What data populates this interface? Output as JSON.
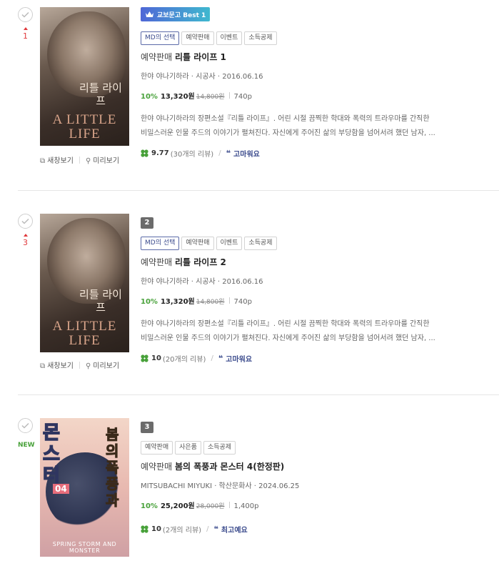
{
  "items": [
    {
      "rank_label": "1",
      "badge": "교보문고 Best 1",
      "tags": [
        "MD의 선택",
        "예약판매",
        "이벤트",
        "소득공제"
      ],
      "title_prefix": "예약판매",
      "title": "리틀 라이프 1",
      "meta": "한야 야나기하라 · 시공사 · 2016.06.16",
      "discount": "10%",
      "price": "13,320원",
      "orig_price": "14,800원",
      "pages": "740p",
      "desc1": "한야 야나기하라의 장편소설『리틀 라이프』. 어린 시절 끔찍한 학대와 폭력의 트라우마를 간직한",
      "desc2": "비밀스러운 인물 주드의 이야기가 펼쳐진다. 자신에게 주어진 삶의 부당함을 넘어서려 했던 남자, ...",
      "score": "9.77",
      "review_count": "(30개의 리뷰)",
      "keyword": "고마워요",
      "cover_ko": "리틀 라이프",
      "cover_en": "A LITTLE LIFE",
      "new_window": "새창보기",
      "preview": "미리보기"
    },
    {
      "rank_label": "3",
      "badge": "2",
      "tags": [
        "MD의 선택",
        "예약판매",
        "이벤트",
        "소득공제"
      ],
      "title_prefix": "예약판매",
      "title": "리틀 라이프 2",
      "meta": "한야 야나기하라 · 시공사 · 2016.06.16",
      "discount": "10%",
      "price": "13,320원",
      "orig_price": "14,800원",
      "pages": "740p",
      "desc1": "한야 야나기하라의 장편소설『리틀 라이프』. 어린 시절 끔찍한 학대와 폭력의 트라우마를 간직한",
      "desc2": "비밀스러운 인물 주드의 이야기가 펼쳐진다. 자신에게 주어진 삶의 부당함을 넘어서려 했던 남자, ...",
      "score": "10",
      "review_count": "(20개의 리뷰)",
      "keyword": "고마워요",
      "cover_ko": "리틀 라이프",
      "cover_en": "A LITTLE LIFE",
      "new_window": "새창보기",
      "preview": "미리보기"
    },
    {
      "rank_label": "NEW",
      "badge": "3",
      "tags": [
        "예약판매",
        "사은품",
        "소득공제"
      ],
      "title_prefix": "예약판매",
      "title": "봄의 폭풍과 몬스터 4(한정판)",
      "meta": "MITSUBACHI MIYUKI · 학산문화사 · 2024.06.25",
      "discount": "10%",
      "price": "25,200원",
      "orig_price": "28,000원",
      "pages": "1,400p",
      "score": "10",
      "review_count": "(2개의 리뷰)",
      "keyword": "최고예요",
      "cover_ko1": "몬스터",
      "cover_ko2": "봄의 폭풍과",
      "cover_vol": "04",
      "cover_en": "SPRING STORM AND MONSTER"
    }
  ],
  "colors": {
    "discount": "#48a13a",
    "rank_up": "#e0383b",
    "keyword": "#3a4a8c"
  }
}
